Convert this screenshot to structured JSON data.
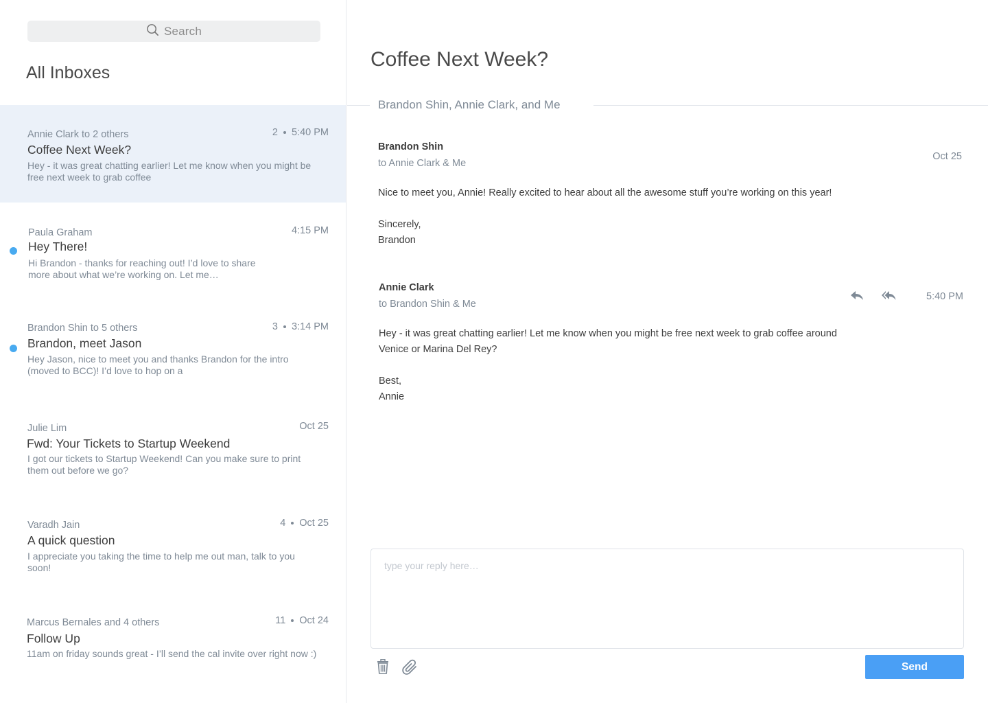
{
  "search": {
    "label": "Search"
  },
  "inbox": {
    "title": "All Inboxes"
  },
  "threads": [
    {
      "sender": "Annie Clark to 2 others",
      "count": "2",
      "time": "5:40 PM",
      "subject": "Coffee Next Week?",
      "snippet": "Hey - it was great chatting earlier! Let me know when you might be free next week to grab coffee",
      "unread": false,
      "selected": true
    },
    {
      "sender": "Paula Graham",
      "count": "",
      "time": "4:15 PM",
      "subject": "Hey There!",
      "snippet": "Hi Brandon - thanks for reaching out! I’d love to share more about what we’re working on. Let me…",
      "unread": true,
      "selected": false
    },
    {
      "sender": "Brandon Shin to 5 others",
      "count": "3",
      "time": "3:14 PM",
      "subject": "Brandon, meet Jason",
      "snippet": "Hey Jason, nice to meet you and thanks Brandon for the intro (moved to BCC)! I’d love to hop on a",
      "unread": true,
      "selected": false
    },
    {
      "sender": "Julie Lim",
      "count": "",
      "time": "Oct 25",
      "subject": "Fwd: Your Tickets to Startup Weekend",
      "snippet": "I got our tickets to Startup Weekend! Can you make sure to print them out before we go?",
      "unread": false,
      "selected": false
    },
    {
      "sender": "Varadh Jain",
      "count": "4",
      "time": "Oct 25",
      "subject": "A quick question",
      "snippet": "I appreciate you taking the time to help me out man, talk to you soon!",
      "unread": false,
      "selected": false
    },
    {
      "sender": "Marcus Bernales and 4 others",
      "count": "11",
      "time": "Oct 24",
      "subject": "Follow Up",
      "snippet": "11am on friday sounds great - I’ll send the cal invite over right now :)",
      "unread": false,
      "selected": false
    }
  ],
  "conversation": {
    "title": "Coffee Next Week?",
    "participants": "Brandon Shin, Annie Clark, and Me",
    "messages": [
      {
        "from": "Brandon Shin",
        "to": "to Annie Clark & Me",
        "time": "Oct 25",
        "body": [
          "Nice to meet you, Annie! Really excited to hear about all the awesome stuff you’re working on this year!",
          "Sincerely,\nBrandon"
        ]
      },
      {
        "from": "Annie Clark",
        "to": "to Brandon Shin & Me",
        "time": "5:40 PM",
        "body": [
          "Hey - it was great chatting earlier! Let me know when you might be free next week to grab coffee around\nVenice or Marina Del Rey?",
          "Best,\nAnnie"
        ]
      }
    ]
  },
  "composer": {
    "placeholder": "type your reply here…",
    "send_label": "Send"
  },
  "icons": {
    "search": "search-icon",
    "reply": "reply-icon",
    "reply_all": "reply-all-icon",
    "trash": "trash-icon",
    "attach": "paperclip-icon"
  },
  "colors": {
    "accent": "#4a9ff5",
    "unread": "#48aaf0",
    "selected_bg": "#ebf1f9",
    "muted": "#7f8a96"
  }
}
